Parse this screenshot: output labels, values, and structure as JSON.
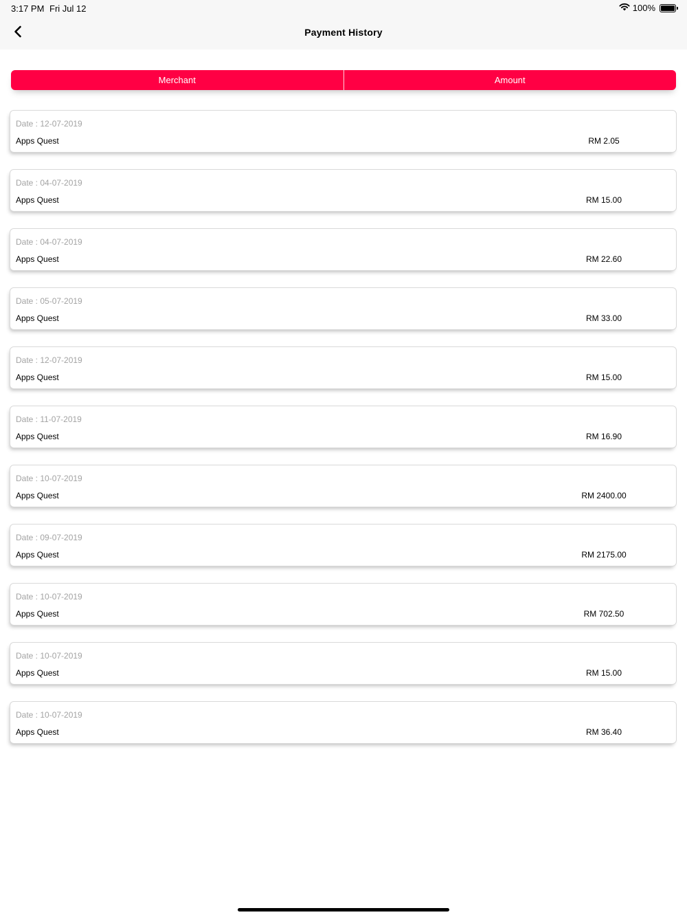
{
  "status_bar": {
    "time": "3:17 PM",
    "date": "Fri Jul 12",
    "battery_text": "100%",
    "icons": [
      "wifi-icon",
      "battery-icon"
    ]
  },
  "nav": {
    "title": "Payment History",
    "back_icon": "chevron-left-icon"
  },
  "segments": {
    "merchant_label": "Merchant",
    "amount_label": "Amount"
  },
  "colors": {
    "accent": "#ff0044",
    "date_text": "#a3a3a3"
  },
  "payments": [
    {
      "date": "Date : 12-07-2019",
      "merchant": "Apps Quest",
      "amount": "RM 2.05"
    },
    {
      "date": "Date : 04-07-2019",
      "merchant": "Apps Quest",
      "amount": "RM 15.00"
    },
    {
      "date": "Date : 04-07-2019",
      "merchant": "Apps Quest",
      "amount": "RM 22.60"
    },
    {
      "date": "Date : 05-07-2019",
      "merchant": "Apps Quest",
      "amount": "RM 33.00"
    },
    {
      "date": "Date : 12-07-2019",
      "merchant": "Apps Quest",
      "amount": "RM 15.00"
    },
    {
      "date": "Date : 11-07-2019",
      "merchant": "Apps Quest",
      "amount": "RM 16.90"
    },
    {
      "date": "Date : 10-07-2019",
      "merchant": "Apps Quest",
      "amount": "RM 2400.00"
    },
    {
      "date": "Date : 09-07-2019",
      "merchant": "Apps Quest",
      "amount": "RM 2175.00"
    },
    {
      "date": "Date : 10-07-2019",
      "merchant": "Apps Quest",
      "amount": "RM 702.50"
    },
    {
      "date": "Date : 10-07-2019",
      "merchant": "Apps Quest",
      "amount": "RM 15.00"
    },
    {
      "date": "Date : 10-07-2019",
      "merchant": "Apps Quest",
      "amount": "RM 36.40"
    }
  ]
}
